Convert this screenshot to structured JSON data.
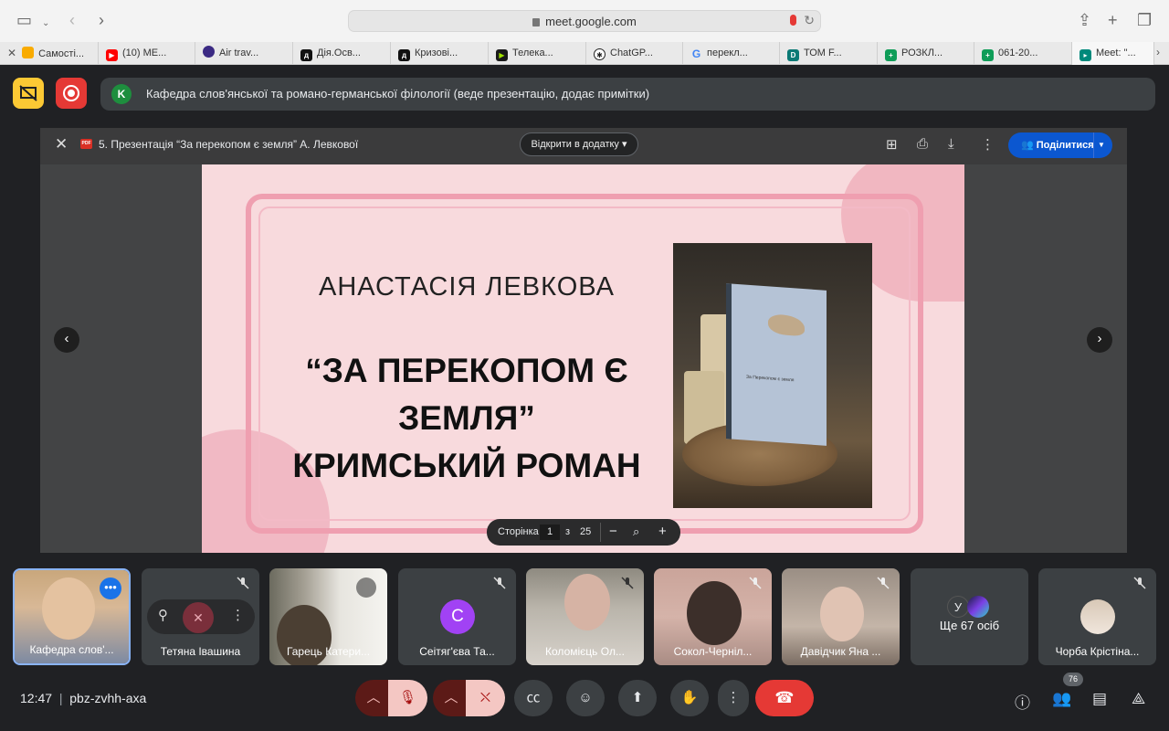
{
  "browser": {
    "url": "meet.google.com",
    "tabs": [
      {
        "label": "Самості...",
        "favicon_color": "#f9ab00"
      },
      {
        "label": "(10) МЕ...",
        "favicon_color": "#ff0000"
      },
      {
        "label": "Air trav...",
        "favicon_color": "#3b2a83"
      },
      {
        "label": "Дія.Осв...",
        "favicon_color": "#111111"
      },
      {
        "label": "Кризові...",
        "favicon_color": "#111111"
      },
      {
        "label": "Телека...",
        "favicon_color": "#1a1a1a"
      },
      {
        "label": "ChatGP...",
        "favicon_color": "#222222"
      },
      {
        "label": "перекл...",
        "favicon_color": "#4285f4"
      },
      {
        "label": "ТОМ F...",
        "favicon_color": "#0b7a75"
      },
      {
        "label": "РОЗКЛ...",
        "favicon_color": "#0f9d58"
      },
      {
        "label": "061-20...",
        "favicon_color": "#0f9d58"
      },
      {
        "label": "Meet: \"...",
        "favicon_color": "#00897b"
      }
    ]
  },
  "presentation_bar": {
    "avatar_letter": "K",
    "text": "Кафедра слов'янської та романо-германської філології (веде презентацію, додає примітки)"
  },
  "viewer": {
    "title": "5. Презентація “За перекопом є земля” А. Левкової",
    "pdf_badge": "PDF",
    "open_with": "Відкрити в додатку",
    "share": "Поділитися"
  },
  "slide": {
    "author": "АНАСТАСІЯ ЛЕВКОВА",
    "title_line1": "“ЗА ПЕРЕКОПОМ Є",
    "title_line2": "ЗЕМЛЯ”",
    "title_line3": "КРИМСЬКИЙ РОМАН",
    "book_text": "За Перекопом є земля"
  },
  "page_control": {
    "label": "Сторінка",
    "current": "1",
    "of": "з",
    "total": "25"
  },
  "participants": [
    {
      "name": "Кафедра слов'...",
      "type": "video"
    },
    {
      "name": "Тетяна Івашина",
      "type": "hover"
    },
    {
      "name": "Гарець Катери...",
      "type": "video"
    },
    {
      "name": "Сеітяг'єва Та...",
      "type": "avatar",
      "letter": "С"
    },
    {
      "name": "Коломієць Ол...",
      "type": "video"
    },
    {
      "name": "Сокол-Черніл...",
      "type": "video"
    },
    {
      "name": "Давідчик Яна ...",
      "type": "video"
    },
    {
      "name": "Ще 67 осіб",
      "type": "more",
      "letter": "У"
    },
    {
      "name": "Чорба Крістіна...",
      "type": "small-avatar"
    }
  ],
  "meeting": {
    "time": "12:47",
    "separator": "|",
    "code": "pbz-zvhh-axa",
    "participant_count": "76"
  },
  "colors": {
    "accent": "#8ab4f8",
    "end_call": "#e53935",
    "share": "#0b57d0"
  }
}
